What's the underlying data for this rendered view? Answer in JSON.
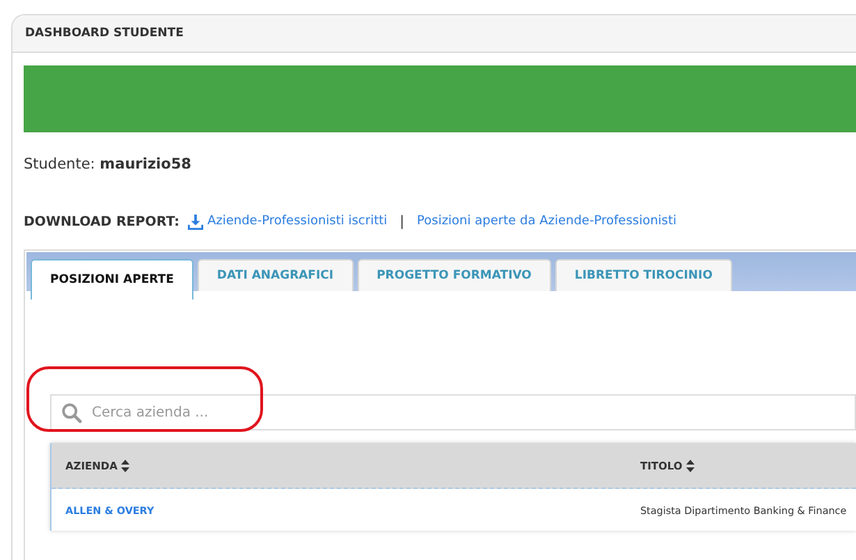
{
  "panel": {
    "title": "DASHBOARD STUDENTE"
  },
  "student": {
    "label": "Studente:",
    "username": "maurizio58"
  },
  "download_report": {
    "label": "DOWNLOAD REPORT:",
    "links": [
      {
        "text": "Aziende-Professionisti iscritti",
        "icon": true
      },
      {
        "text": "Posizioni aperte da Aziende-Professionisti",
        "icon": false
      }
    ],
    "separator": "|"
  },
  "tabs": [
    {
      "label": "POSIZIONI APERTE",
      "selected": true
    },
    {
      "label": "DATI ANAGRAFICI",
      "selected": false
    },
    {
      "label": "PROGETTO FORMATIVO",
      "selected": false
    },
    {
      "label": "LIBRETTO TIROCINIO",
      "selected": false
    }
  ],
  "search": {
    "placeholder": "Cerca azienda ..."
  },
  "table": {
    "columns": [
      "AZIENDA",
      "TITOLO"
    ],
    "rows": [
      [
        "ALLEN & OVERY",
        "Stagista Dipartimento Banking & Finance"
      ]
    ]
  }
}
